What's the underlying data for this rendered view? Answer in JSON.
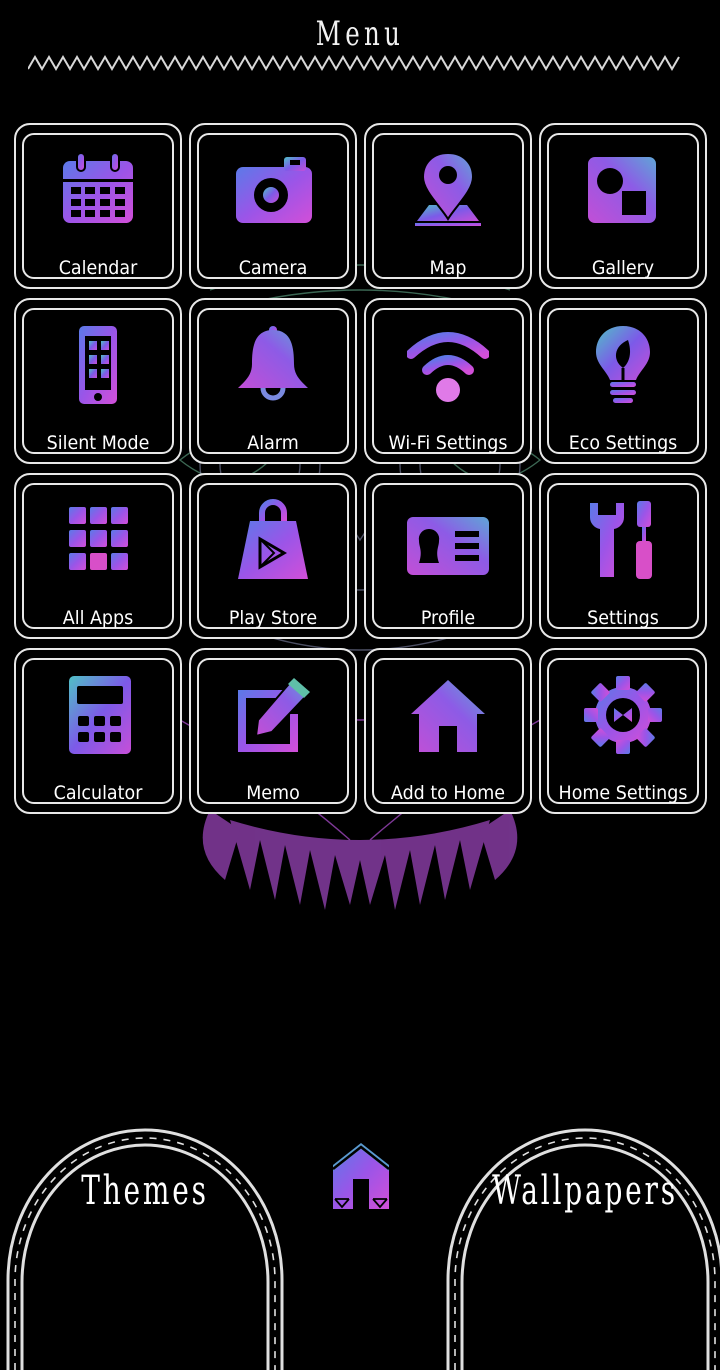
{
  "header": {
    "title": "Menu"
  },
  "theme": {
    "gradient_stops": [
      "#5b6fe0",
      "#9a4fe6",
      "#d34fd8"
    ],
    "gradient_alt": [
      "#4fb8c9",
      "#7a5be6",
      "#c24fd6"
    ],
    "frame_color": "#e8e8e8",
    "owl_color": "#8c3fa8"
  },
  "tiles": [
    {
      "label": "Calendar",
      "icon": "calendar-icon"
    },
    {
      "label": "Camera",
      "icon": "camera-icon"
    },
    {
      "label": "Map",
      "icon": "map-pin-icon"
    },
    {
      "label": "Gallery",
      "icon": "gallery-icon"
    },
    {
      "label": "Silent Mode",
      "icon": "phone-icon"
    },
    {
      "label": "Alarm",
      "icon": "bell-icon"
    },
    {
      "label": "Wi-Fi Settings",
      "icon": "wifi-icon"
    },
    {
      "label": "Eco Settings",
      "icon": "lightbulb-leaf-icon"
    },
    {
      "label": "All Apps",
      "icon": "app-grid-icon"
    },
    {
      "label": "Play Store",
      "icon": "shopping-bag-play-icon"
    },
    {
      "label": "Profile",
      "icon": "id-card-icon"
    },
    {
      "label": "Settings",
      "icon": "wrench-screwdriver-icon"
    },
    {
      "label": "Calculator",
      "icon": "calculator-icon"
    },
    {
      "label": "Memo",
      "icon": "pencil-square-icon"
    },
    {
      "label": "Add to Home",
      "icon": "house-icon"
    },
    {
      "label": "Home Settings",
      "icon": "gear-icon"
    }
  ],
  "bottom_nav": {
    "themes_label": "Themes",
    "wallpapers_label": "Wallpapers",
    "home_icon": "home-icon"
  }
}
